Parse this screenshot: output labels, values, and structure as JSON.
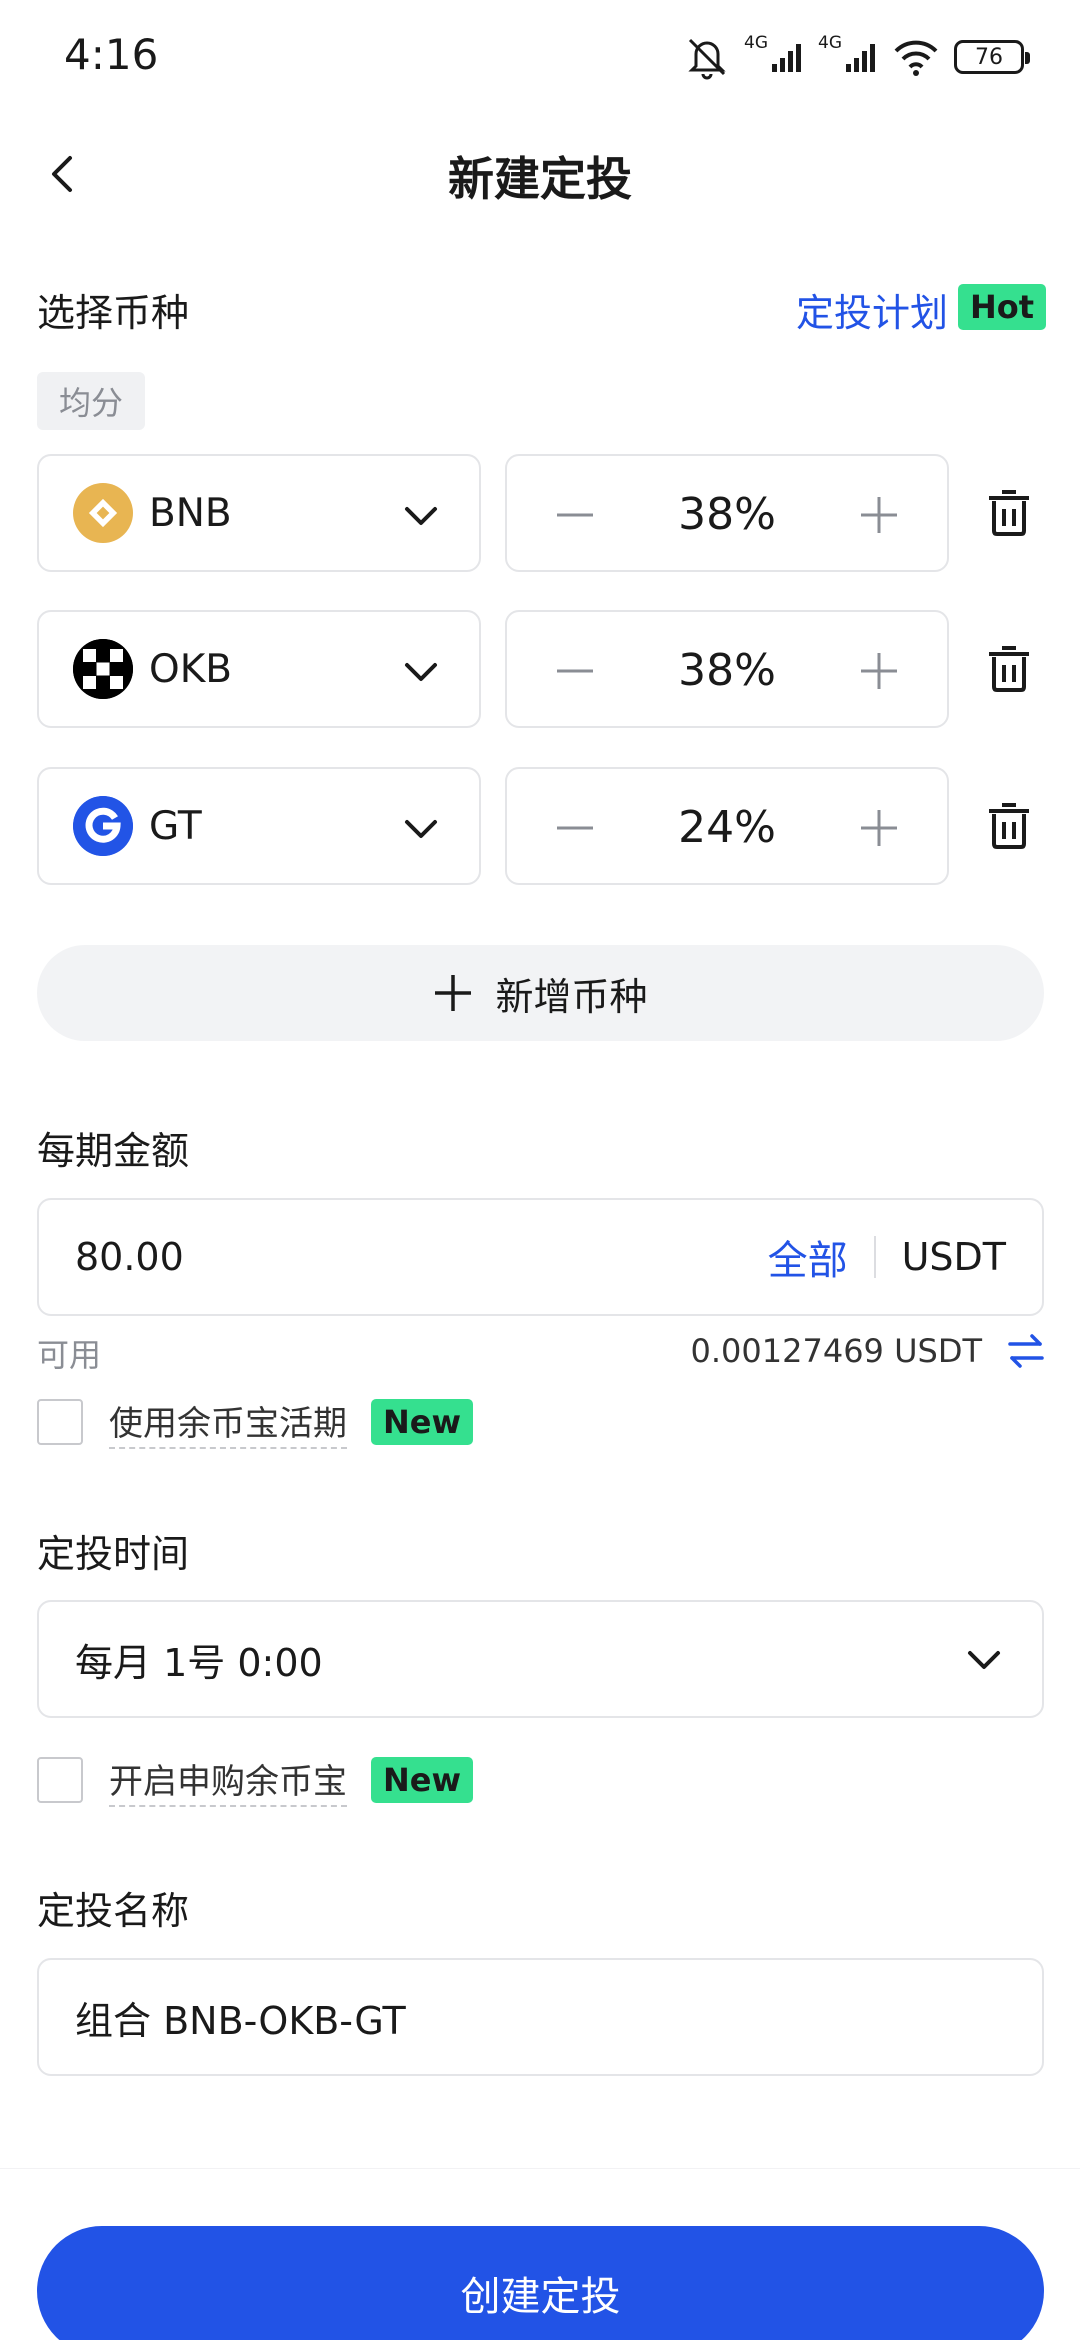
{
  "status_bar": {
    "time": "4:16",
    "network_1": "4G",
    "network_2": "4G",
    "battery": "76",
    "icons": [
      "mute-bell-icon",
      "signal-icon",
      "signal-icon",
      "wifi-icon",
      "battery-icon"
    ]
  },
  "nav": {
    "title": "新建定投",
    "back_icon": "chevron-left-icon"
  },
  "coin_section": {
    "label": "选择币种",
    "plan_link": "定投计划",
    "hot_badge": "Hot",
    "split_chip": "均分",
    "coins": [
      {
        "name": "BNB",
        "percent": "38%",
        "logo_color": "#e8b552"
      },
      {
        "name": "OKB",
        "percent": "38%",
        "logo_color": "#000000"
      },
      {
        "name": "GT",
        "percent": "24%",
        "logo_color": "#2254e6"
      }
    ],
    "add_label": "新增币种"
  },
  "amount_section": {
    "label": "每期金额",
    "value": "80.00",
    "all_label": "全部",
    "unit": "USDT",
    "available_label": "可用",
    "available_value": "0.00127469 USDT",
    "checkbox_label": "使用余币宝活期",
    "new_badge": "New"
  },
  "time_section": {
    "label": "定投时间",
    "value": "每月 1号 0:00",
    "checkbox_label": "开启申购余币宝",
    "new_badge": "New"
  },
  "name_section": {
    "label": "定投名称",
    "value": "组合 BNB-OKB-GT"
  },
  "create_button": "创建定投",
  "colors": {
    "accent": "#2253e6",
    "badge_green": "#35e08f",
    "border": "#e4e5e8",
    "muted_text": "#8a8d94"
  }
}
